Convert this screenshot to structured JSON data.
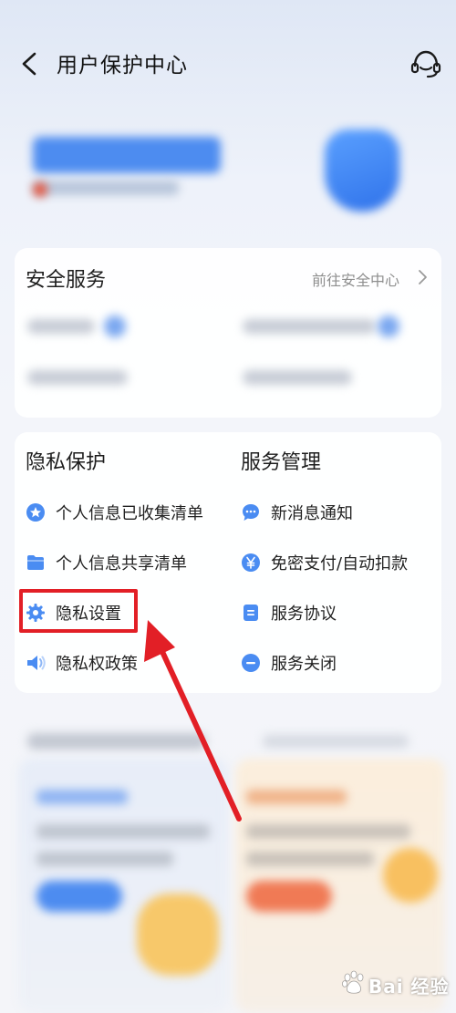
{
  "header": {
    "title": "用户保护中心",
    "back_icon": "chevron-left-icon",
    "support_icon": "headset-icon"
  },
  "security": {
    "title": "安全服务",
    "link": "前往安全中心"
  },
  "privacy": {
    "title": "隐私保护",
    "items": [
      {
        "label": "个人信息已收集清单",
        "icon": "star-circle-icon"
      },
      {
        "label": "个人信息共享清单",
        "icon": "folder-icon"
      },
      {
        "label": "隐私设置",
        "icon": "gear-icon"
      },
      {
        "label": "隐私权政策",
        "icon": "speaker-icon"
      }
    ]
  },
  "service": {
    "title": "服务管理",
    "items": [
      {
        "label": "新消息通知",
        "icon": "chat-bubble-icon"
      },
      {
        "label": "免密支付/自动扣款",
        "icon": "yen-circle-icon"
      },
      {
        "label": "服务协议",
        "icon": "document-icon"
      },
      {
        "label": "服务关闭",
        "icon": "minus-circle-icon"
      }
    ]
  },
  "annotation": {
    "highlight_color": "#e21f26"
  },
  "colors": {
    "accent": "#4a8cf2",
    "text": "#222222",
    "muted": "#8e8e8e"
  },
  "watermark": {
    "text": "Bai 经验"
  }
}
